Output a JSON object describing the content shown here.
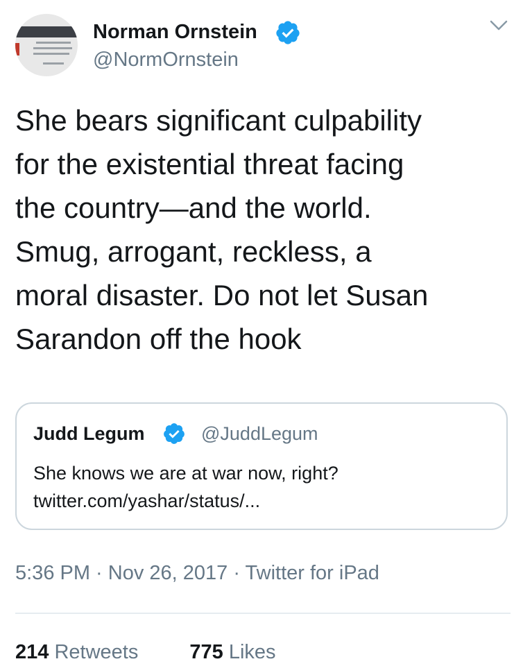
{
  "tweet": {
    "author": {
      "name": "Norman Ornstein",
      "handle": "@NormOrnstein",
      "verified_icon": "verified-badge-icon",
      "verified_color": "#1da1f2"
    },
    "menu_icon": "chevron-down-icon",
    "text": "She bears significant culpability\nfor the existential threat facing\nthe country—and the world.\nSmug, arrogant, reckless, a\nmoral disaster. Do not let Susan\nSarandon off the hook",
    "quoted": {
      "name": "Judd Legum",
      "handle": "@JuddLegum",
      "text": "She knows we are at war now, right?\ntwitter.com/yashar/status/..."
    },
    "meta": "5:36 PM · Nov 26, 2017 · Twitter for iPad",
    "stats": {
      "retweets_count": "214",
      "retweets_label": "Retweets",
      "likes_count": "775",
      "likes_label": "Likes"
    }
  },
  "colors": {
    "primary_text": "#14171a",
    "secondary_text": "#657786",
    "border": "#ccd6dd",
    "divider": "#e6ecf0",
    "accent": "#1da1f2"
  }
}
